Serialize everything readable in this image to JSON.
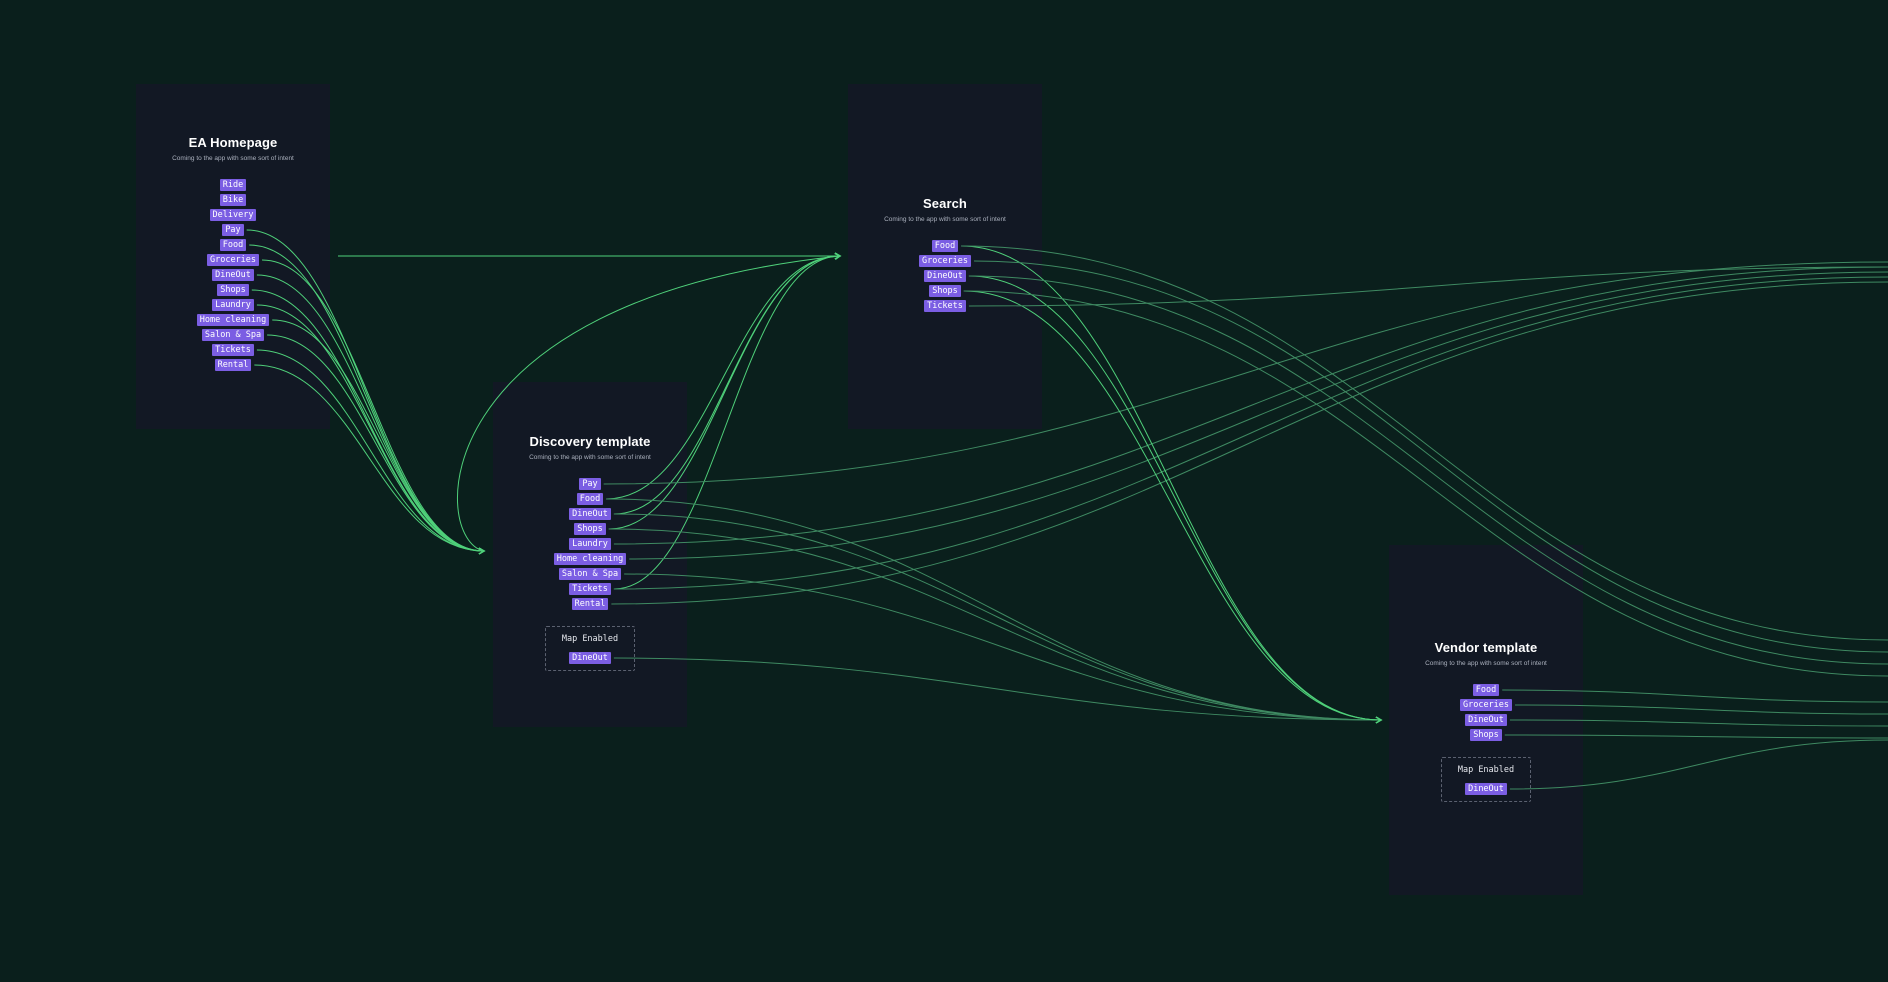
{
  "colors": {
    "background": "#0a1f1c",
    "card": "#121824",
    "chip": "#7b5ee3",
    "connector_dim": "#3f8a62",
    "connector_bright": "#4fd07a"
  },
  "cards": {
    "ea_homepage": {
      "title": "EA Homepage",
      "subtitle": "Coming to the app with some sort of intent",
      "chips": [
        "Ride",
        "Bike",
        "Delivery",
        "Pay",
        "Food",
        "Groceries",
        "DineOut",
        "Shops",
        "Laundry",
        "Home cleaning",
        "Salon & Spa",
        "Tickets",
        "Rental"
      ]
    },
    "search": {
      "title": "Search",
      "subtitle": "Coming to the app with some sort of intent",
      "chips": [
        "Food",
        "Groceries",
        "DineOut",
        "Shops",
        "Tickets"
      ]
    },
    "discovery_template": {
      "title": "Discovery template",
      "subtitle": "Coming to the app with some sort of intent",
      "chips": [
        "Pay",
        "Food",
        "DineOut",
        "Shops",
        "Laundry",
        "Home cleaning",
        "Salon & Spa",
        "Tickets",
        "Rental"
      ],
      "map": {
        "label": "Map Enabled",
        "chips": [
          "DineOut"
        ]
      }
    },
    "vendor_template": {
      "title": "Vendor template",
      "subtitle": "Coming to the app with some sort of intent",
      "chips": [
        "Food",
        "Groceries",
        "DineOut",
        "Shops"
      ],
      "map": {
        "label": "Map Enabled",
        "chips": [
          "DineOut"
        ]
      }
    }
  }
}
